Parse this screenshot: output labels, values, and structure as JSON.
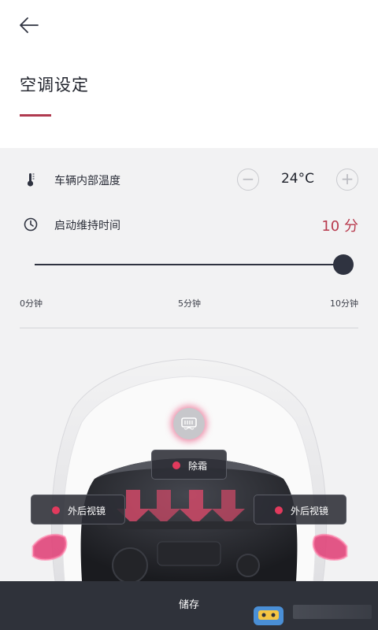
{
  "header": {
    "back_icon": "arrow-left-icon",
    "title": "空调设定"
  },
  "temperature": {
    "icon": "thermometer-icon",
    "label": "车辆内部温度",
    "minus_label": "−",
    "plus_label": "+",
    "value": "24°C"
  },
  "duration": {
    "icon": "clock-icon",
    "label": "启动维持时间",
    "value": "10 分",
    "accent_color": "#b83a4d"
  },
  "slider": {
    "min_label": "0分钟",
    "mid_label": "5分钟",
    "max_label": "10分钟",
    "level_fraction": 1.0
  },
  "car_controls": {
    "defrost_icon": "rear-defrost-icon",
    "defrost_label": "除霜",
    "mirror_left_label": "外后视镜",
    "mirror_right_label": "外后视镜",
    "active_dot_color": "#e23a5d"
  },
  "footer": {
    "save_label": "储存"
  }
}
